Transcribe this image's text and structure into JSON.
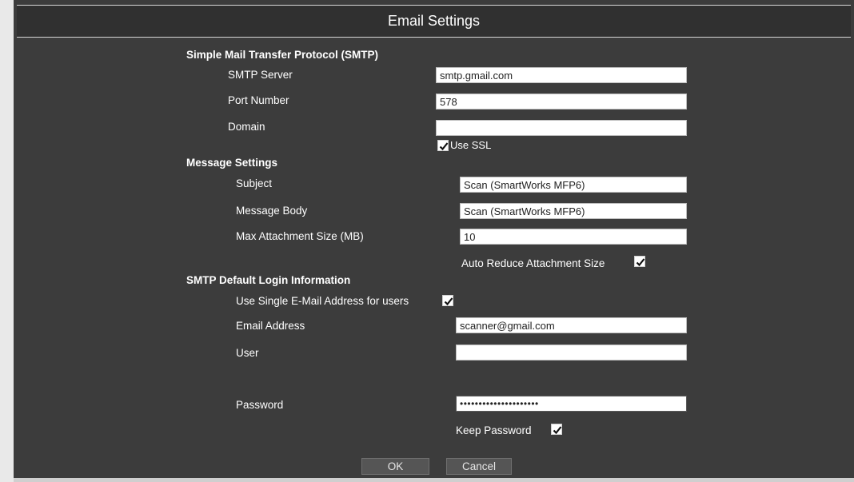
{
  "dialog": {
    "title": "Email Settings"
  },
  "smtp": {
    "heading": "Simple Mail Transfer Protocol (SMTP)",
    "server_label": "SMTP Server",
    "server_value": "smtp.gmail.com",
    "port_label": "Port Number",
    "port_value": "578",
    "domain_label": "Domain",
    "domain_value": "",
    "ssl_label": "Use SSL",
    "ssl_checked": true
  },
  "message": {
    "heading": "Message Settings",
    "subject_label": "Subject",
    "subject_value": "Scan (SmartWorks MFP6)",
    "body_label": "Message Body",
    "body_value": "Scan (SmartWorks MFP6)",
    "max_size_label": "Max Attachment Size (MB)",
    "max_size_value": "10",
    "auto_reduce_label": "Auto Reduce Attachment Size",
    "auto_reduce_checked": true
  },
  "login": {
    "heading": "SMTP Default Login Information",
    "single_email_label": "Use Single E-Mail Address for users",
    "single_email_checked": true,
    "email_label": "Email Address",
    "email_value": "scanner@gmail.com",
    "user_label": "User",
    "user_value": "",
    "password_label": "Password",
    "password_value": "•••••••••••••••••••••",
    "keep_password_label": "Keep Password",
    "keep_password_checked": true
  },
  "buttons": {
    "ok": "OK",
    "cancel": "Cancel"
  }
}
